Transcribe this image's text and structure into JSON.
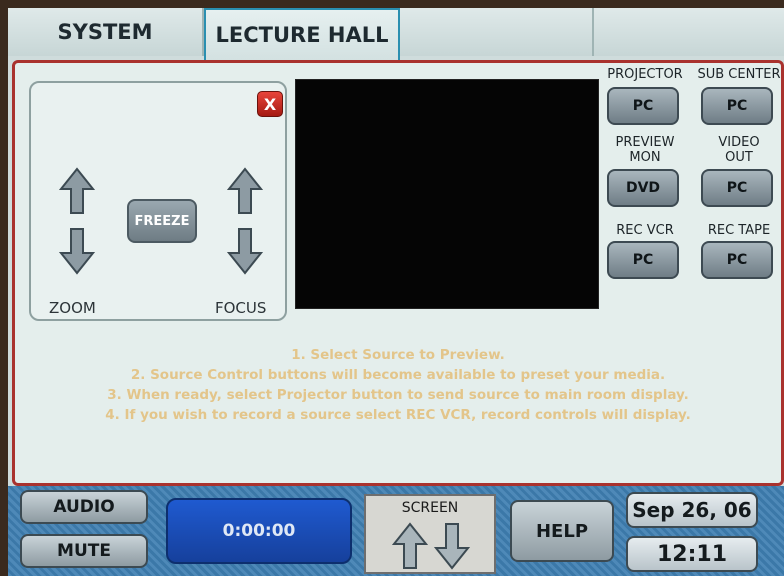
{
  "tabs": [
    {
      "label": "SYSTEM",
      "active": false
    },
    {
      "label": "LECTURE HALL",
      "active": true
    },
    {
      "label": "",
      "active": false
    },
    {
      "label": "",
      "active": false
    }
  ],
  "camera": {
    "close_label": "X",
    "freeze_label": "FREEZE",
    "zoom_label": "ZOOM",
    "focus_label": "FOCUS"
  },
  "destinations": [
    {
      "label": "PROJECTOR",
      "source": "PC"
    },
    {
      "label": "SUB CENTER",
      "source": "PC"
    },
    {
      "label": "PREVIEW\nMON",
      "source": "DVD"
    },
    {
      "label": "VIDEO\nOUT",
      "source": "PC"
    },
    {
      "label": "REC VCR",
      "source": "PC"
    },
    {
      "label": "REC TAPE",
      "source": "PC"
    }
  ],
  "instructions": [
    "1. Select Source to Preview.",
    "2. Source Control buttons will become available to preset your media.",
    "3. When ready, select Projector button to send source to main room display.",
    "4. If you wish to record a source select REC VCR, record controls will display."
  ],
  "bottom": {
    "audio_label": "AUDIO",
    "mute_label": "MUTE",
    "timer": "0:00:00",
    "screen_label": "SCREEN",
    "help_label": "HELP",
    "date": "Sep 26, 06",
    "time": "12:11"
  },
  "colors": {
    "accent_red": "#a9322e",
    "instruction_text": "#e3c58a",
    "timer_blue": "#1f5ad0",
    "bottom_bar": "#3f7fb2"
  }
}
